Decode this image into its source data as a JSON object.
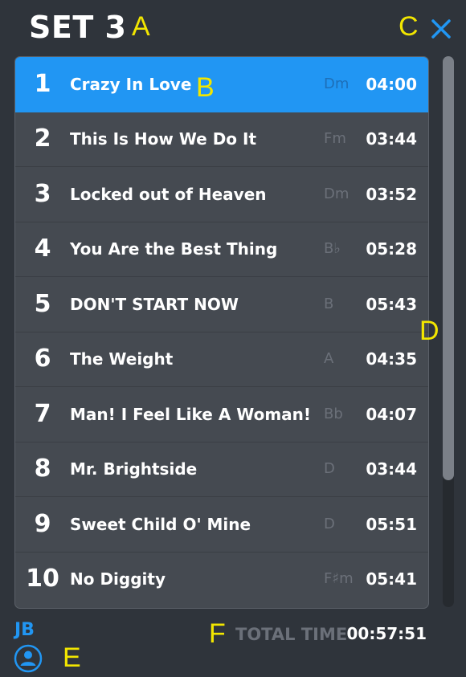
{
  "header": {
    "title": "SET 3"
  },
  "annotations": {
    "a": "A",
    "b": "B",
    "c": "C",
    "d": "D",
    "e": "E",
    "f": "F"
  },
  "songs": [
    {
      "num": "1",
      "title": "Crazy In Love",
      "key": "Dm",
      "time": "04:00",
      "active": true
    },
    {
      "num": "2",
      "title": "This Is How We Do It",
      "key": "Fm",
      "time": "03:44"
    },
    {
      "num": "3",
      "title": "Locked out of Heaven",
      "key": "Dm",
      "time": "03:52"
    },
    {
      "num": "4",
      "title": "You Are the Best Thing",
      "key": "B♭",
      "time": "05:28"
    },
    {
      "num": "5",
      "title": "DON'T START NOW",
      "key": "B",
      "time": "05:43"
    },
    {
      "num": "6",
      "title": "The Weight",
      "key": "A",
      "time": "04:35"
    },
    {
      "num": "7",
      "title": "Man! I Feel Like A Woman!",
      "key": "Bb",
      "time": "04:07"
    },
    {
      "num": "8",
      "title": "Mr. Brightside",
      "key": "D",
      "time": "03:44"
    },
    {
      "num": "9",
      "title": "Sweet Child O' Mine",
      "key": "D",
      "time": "05:51"
    },
    {
      "num": "10",
      "title": "No Diggity",
      "key": "F♯m",
      "time": "05:41"
    }
  ],
  "footer": {
    "initials": "JB",
    "total_label": "TOTAL TIME",
    "total_time": "00:57:51"
  },
  "icons": {
    "close": "close-icon",
    "user": "user-icon"
  },
  "colors": {
    "accent": "#2196f3",
    "background": "#2f343b",
    "annotation": "#f2e600"
  }
}
